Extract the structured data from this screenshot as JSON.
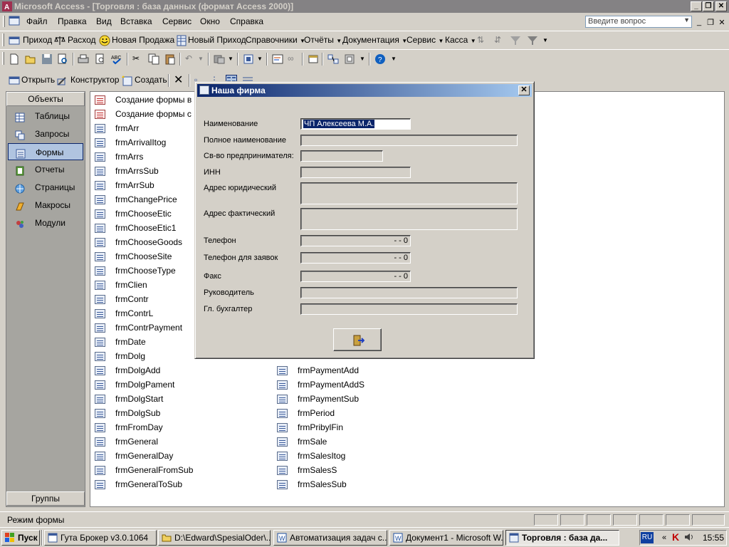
{
  "app": {
    "title": "Microsoft Access - [Торговля : база данных (формат Access 2000)]"
  },
  "menu": {
    "items": [
      "Файл",
      "Правка",
      "Вид",
      "Вставка",
      "Сервис",
      "Окно",
      "Справка"
    ],
    "ask_placeholder": "Введите вопрос"
  },
  "custom_toolbar": {
    "items": [
      "Приход",
      "Расход",
      "Новая Продажа",
      "Новый Приход",
      "Справочники",
      "Отчёты",
      "Документация",
      "Сервис",
      "Касса"
    ]
  },
  "db_toolbar": {
    "open": "Открыть",
    "design": "Конструктор",
    "create": "Создать"
  },
  "objects_panel": {
    "header": "Объекты",
    "groups": "Группы",
    "items": [
      "Таблицы",
      "Запросы",
      "Формы",
      "Отчеты",
      "Страницы",
      "Макросы",
      "Модули"
    ],
    "selected": "Формы"
  },
  "forms_list": {
    "column1": [
      "Создание формы в ре",
      "Создание формы с по",
      "frmArr",
      "frmArrivalItog",
      "frmArrs",
      "frmArrsSub",
      "frmArrSub",
      "frmChangePrice",
      "frmChooseEtic",
      "frmChooseEtic1",
      "frmChooseGoods",
      "frmChooseSite",
      "frmChooseType",
      "frmClien",
      "frmContr",
      "frmContrL",
      "frmContrPayment",
      "frmDate",
      "frmDolg",
      "frmDolgAdd",
      "frmDolgPament",
      "frmDolgStart",
      "frmDolgSub",
      "frmFromDay",
      "frmGeneral",
      "frmGeneralDay",
      "frmGeneralFromSub",
      "frmGeneralToSub"
    ],
    "column2": [
      "frmPaymentAdd",
      "frmPaymentAddS",
      "frmPaymentSub",
      "frmPeriod",
      "frmPribylFin",
      "frmSale",
      "frmSalesItog",
      "frmSalesS",
      "frmSalesSub"
    ]
  },
  "dialog": {
    "title": "Наша фирма",
    "fields": [
      {
        "label": "Наименование",
        "value": "ЧП Алексеева М.А."
      },
      {
        "label": "Полное наименование",
        "value": ""
      },
      {
        "label": "Св-во предпринимателя:",
        "value": ""
      },
      {
        "label": "ИНН",
        "value": ""
      },
      {
        "label": "Адрес юридический",
        "value": ""
      },
      {
        "label": "Адрес фактический",
        "value": ""
      },
      {
        "label": "Телефон",
        "value": "- - 0"
      },
      {
        "label": "Телефон для заявок",
        "value": "- - 0"
      },
      {
        "label": "Факс",
        "value": "- - 0"
      },
      {
        "label": "Руководитель",
        "value": ""
      },
      {
        "label": "Гл. бухгалтер",
        "value": ""
      }
    ],
    "exit_button_icon": "exit-door-icon"
  },
  "status": {
    "text": "Режим формы"
  },
  "taskbar": {
    "start": "Пуск",
    "tasks": [
      "Гута Брокер v3.0.1064",
      "D:\\Edward\\SpesialOder\\...",
      "Автоматизация задач с...",
      "Документ1 - Microsoft W...",
      "Торговля : база да..."
    ],
    "active_task": 4,
    "lang": "RU",
    "clock": "15:55"
  }
}
